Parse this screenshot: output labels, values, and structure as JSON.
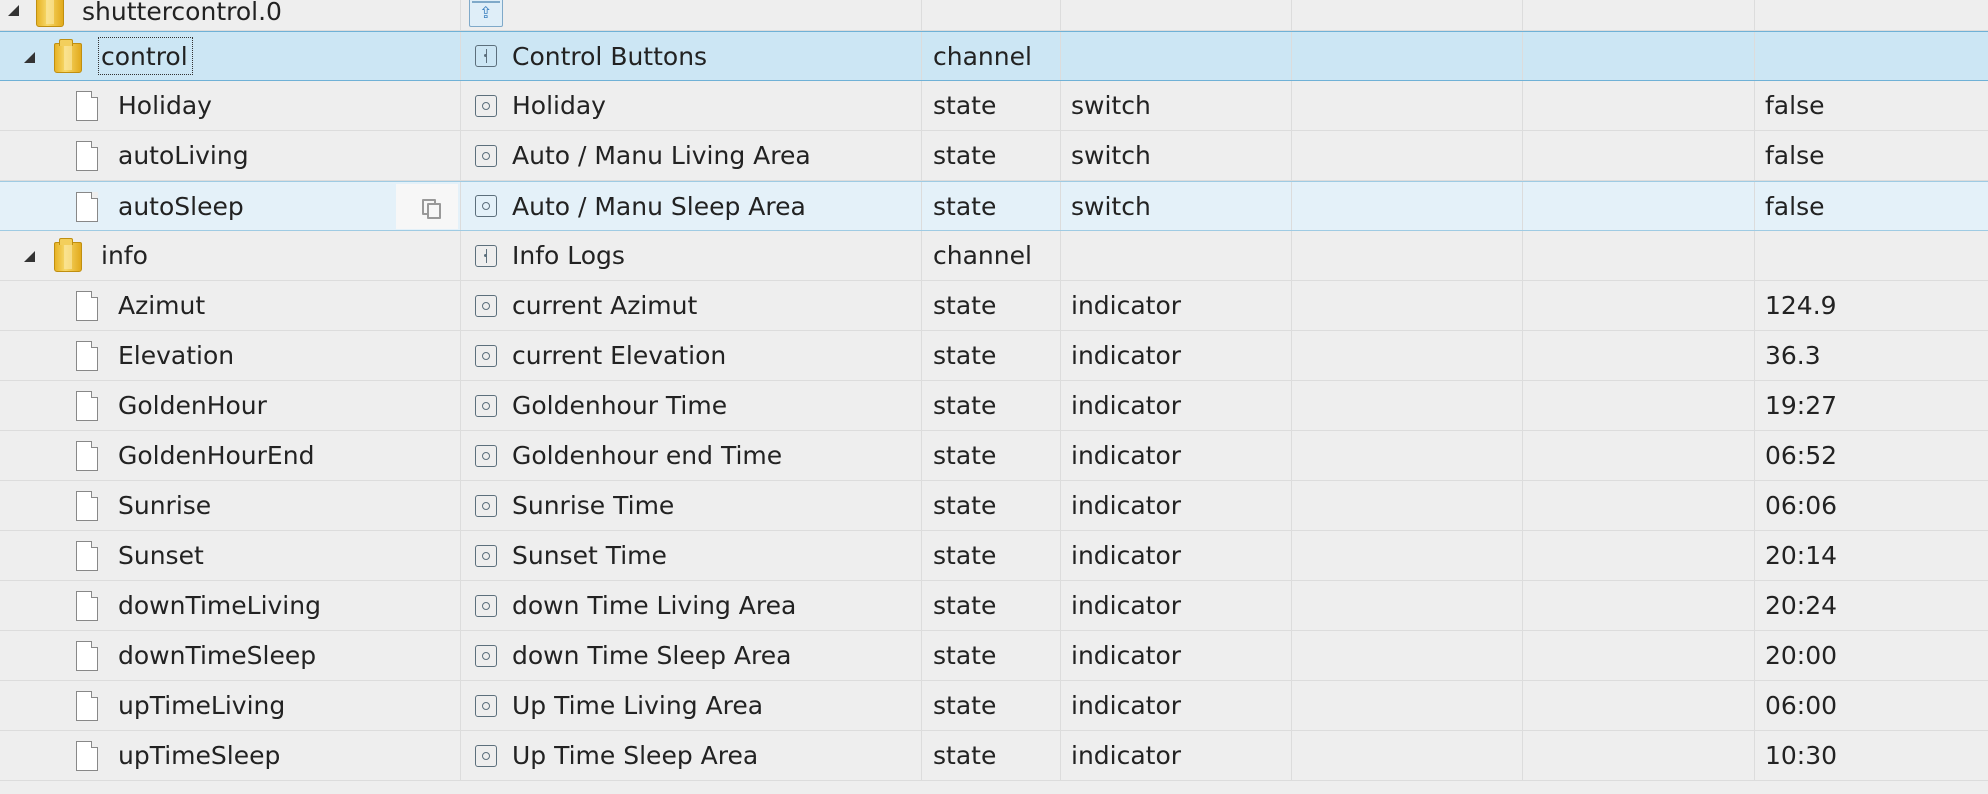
{
  "root": {
    "id": "shuttercontrol.0"
  },
  "rows": [
    {
      "kind": "folder",
      "level": 1,
      "id": "control",
      "name": "Control Buttons",
      "type": "channel",
      "role": "",
      "value": "",
      "selected": true
    },
    {
      "kind": "state",
      "level": 2,
      "id": "Holiday",
      "name": "Holiday",
      "type": "state",
      "role": "switch",
      "value": "false"
    },
    {
      "kind": "state",
      "level": 2,
      "id": "autoLiving",
      "name": "Auto / Manu Living Area",
      "type": "state",
      "role": "switch",
      "value": "false"
    },
    {
      "kind": "state",
      "level": 2,
      "id": "autoSleep",
      "name": "Auto / Manu Sleep Area",
      "type": "state",
      "role": "switch",
      "value": "false",
      "hovered": true
    },
    {
      "kind": "folder",
      "level": 1,
      "id": "info",
      "name": "Info Logs",
      "type": "channel",
      "role": "",
      "value": ""
    },
    {
      "kind": "state",
      "level": 2,
      "id": "Azimut",
      "name": "current Azimut",
      "type": "state",
      "role": "indicator",
      "value": "124.9"
    },
    {
      "kind": "state",
      "level": 2,
      "id": "Elevation",
      "name": "current Elevation",
      "type": "state",
      "role": "indicator",
      "value": "36.3"
    },
    {
      "kind": "state",
      "level": 2,
      "id": "GoldenHour",
      "name": "Goldenhour Time",
      "type": "state",
      "role": "indicator",
      "value": "19:27"
    },
    {
      "kind": "state",
      "level": 2,
      "id": "GoldenHourEnd",
      "name": "Goldenhour end Time",
      "type": "state",
      "role": "indicator",
      "value": "06:52"
    },
    {
      "kind": "state",
      "level": 2,
      "id": "Sunrise",
      "name": "Sunrise Time",
      "type": "state",
      "role": "indicator",
      "value": "06:06"
    },
    {
      "kind": "state",
      "level": 2,
      "id": "Sunset",
      "name": "Sunset Time",
      "type": "state",
      "role": "indicator",
      "value": "20:14"
    },
    {
      "kind": "state",
      "level": 2,
      "id": "downTimeLiving",
      "name": "down Time Living Area",
      "type": "state",
      "role": "indicator",
      "value": "20:24"
    },
    {
      "kind": "state",
      "level": 2,
      "id": "downTimeSleep",
      "name": "down Time Sleep Area",
      "type": "state",
      "role": "indicator",
      "value": "20:00"
    },
    {
      "kind": "state",
      "level": 2,
      "id": "upTimeLiving",
      "name": "Up Time Living Area",
      "type": "state",
      "role": "indicator",
      "value": "06:00"
    },
    {
      "kind": "state",
      "level": 2,
      "id": "upTimeSleep",
      "name": "Up Time Sleep Area",
      "type": "state",
      "role": "indicator",
      "value": "10:30"
    }
  ],
  "icons": {
    "adapter": "adapter-icon",
    "folder": "folder-icon",
    "file": "file-icon",
    "channel": "channel-type-icon",
    "state": "state-type-icon",
    "copy": "copy-icon",
    "expand": "expand-triangle-icon"
  },
  "colors": {
    "selected_row": "#cce6f4",
    "hover_row": "#e4f1f9",
    "background": "#eeeeee"
  }
}
